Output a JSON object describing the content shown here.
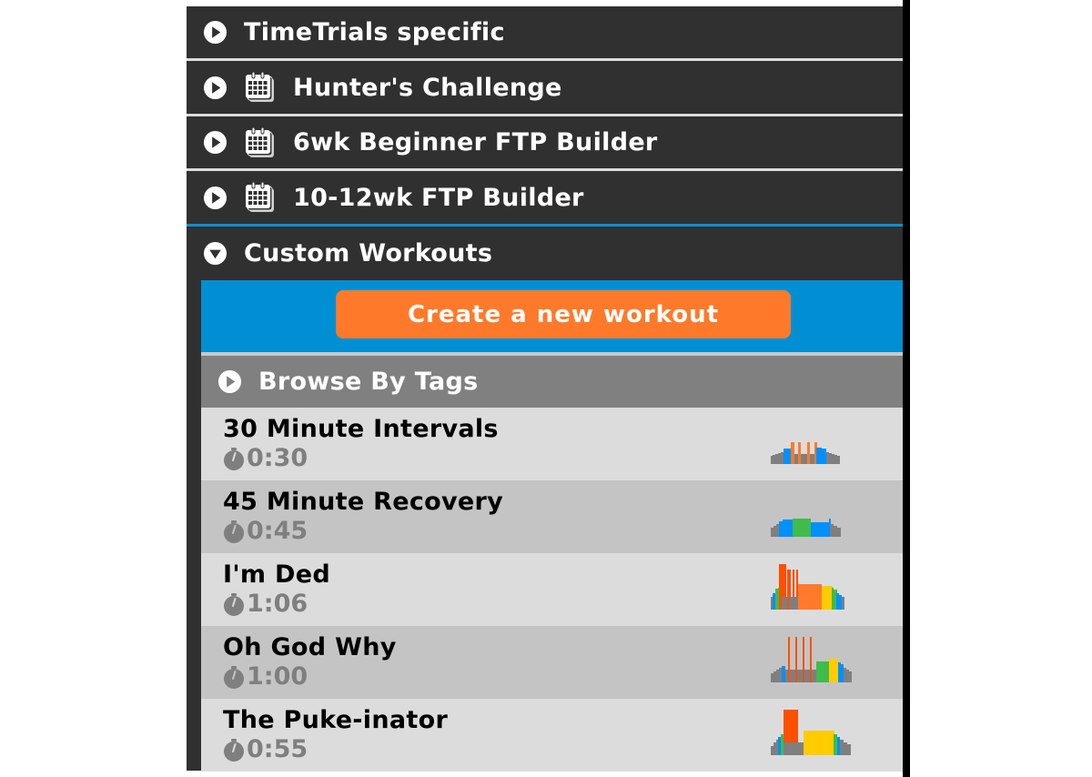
{
  "sections": [
    {
      "label": "TimeTrials specific",
      "expanded": false,
      "icon": "play-circle-icon",
      "has_calendar": false
    },
    {
      "label": "Hunter's Challenge",
      "expanded": false,
      "icon": "play-circle-icon",
      "has_calendar": true
    },
    {
      "label": "6wk Beginner FTP Builder",
      "expanded": false,
      "icon": "play-circle-icon",
      "has_calendar": true
    },
    {
      "label": "10-12wk FTP Builder",
      "expanded": false,
      "icon": "play-circle-icon",
      "has_calendar": true
    },
    {
      "label": "Custom Workouts",
      "expanded": true,
      "icon": "down-circle-icon",
      "has_calendar": false
    }
  ],
  "custom": {
    "create_button": "Create a new workout",
    "browse_tags": "Browse By Tags",
    "workouts": [
      {
        "name": "30 Minute Intervals",
        "duration": "0:30"
      },
      {
        "name": "45 Minute Recovery",
        "duration": "0:45"
      },
      {
        "name": "I'm Ded",
        "duration": "1:06"
      },
      {
        "name": "Oh God Why",
        "duration": "1:00"
      },
      {
        "name": "The Puke-inator",
        "duration": "0:55"
      }
    ]
  },
  "colors": {
    "panel": "#303030",
    "accent_blue": "#018fd3",
    "create_orange": "#fe7a2a",
    "zone_gray": "#7f7f7f",
    "zone_blue": "#0090ff",
    "zone_green": "#3fbc4c",
    "zone_yellow": "#ffcc00",
    "zone_orange": "#ff7a2a",
    "zone_red": "#ff5000"
  }
}
